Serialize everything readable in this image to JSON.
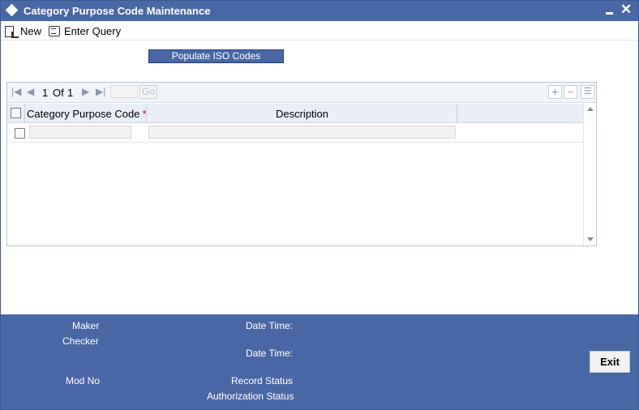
{
  "window": {
    "title": "Category Purpose Code Maintenance"
  },
  "toolbar": {
    "new_label": "New",
    "enter_query_label": "Enter Query"
  },
  "actions": {
    "populate_iso_codes": "Populate ISO Codes"
  },
  "grid": {
    "pager": {
      "current_page": "1",
      "of_label": "Of",
      "total_pages": "1",
      "go_label": "Go"
    },
    "columns": [
      {
        "label": "Category Purpose Code",
        "required": "*"
      },
      {
        "label": "Description"
      }
    ],
    "rows": [
      {
        "category_purpose_code": "",
        "description": ""
      }
    ]
  },
  "footer": {
    "maker_label": "Maker",
    "checker_label": "Checker",
    "date_time_label": "Date Time:",
    "mod_no_label": "Mod No",
    "record_status_label": "Record Status",
    "authorization_status_label": "Authorization Status",
    "exit_label": "Exit"
  },
  "colors": {
    "brand": "#4a67a5",
    "required": "#d00000"
  }
}
